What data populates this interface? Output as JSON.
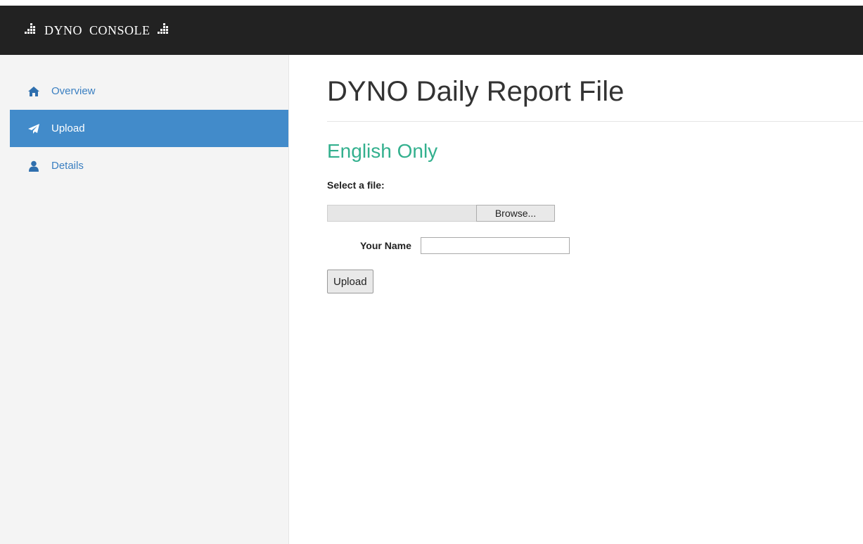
{
  "brand": {
    "word1": "DYNO",
    "word2": "CONSOLE",
    "icon": "equalizer-icon"
  },
  "sidebar": {
    "items": [
      {
        "label": "Overview",
        "icon": "home-icon",
        "active": false
      },
      {
        "label": "Upload",
        "icon": "send-icon",
        "active": true
      },
      {
        "label": "Details",
        "icon": "user-icon",
        "active": false
      }
    ]
  },
  "main": {
    "title": "DYNO Daily Report File",
    "subtitle": "English Only",
    "select_label": "Select a file:",
    "browse_label": "Browse...",
    "name_label": "Your Name",
    "name_value": "",
    "upload_label": "Upload"
  },
  "colors": {
    "navbar": "#222222",
    "sidebar_bg": "#f4f4f4",
    "active_item": "#428bca",
    "link": "#3a7fc1",
    "subtitle": "#33b08e"
  }
}
